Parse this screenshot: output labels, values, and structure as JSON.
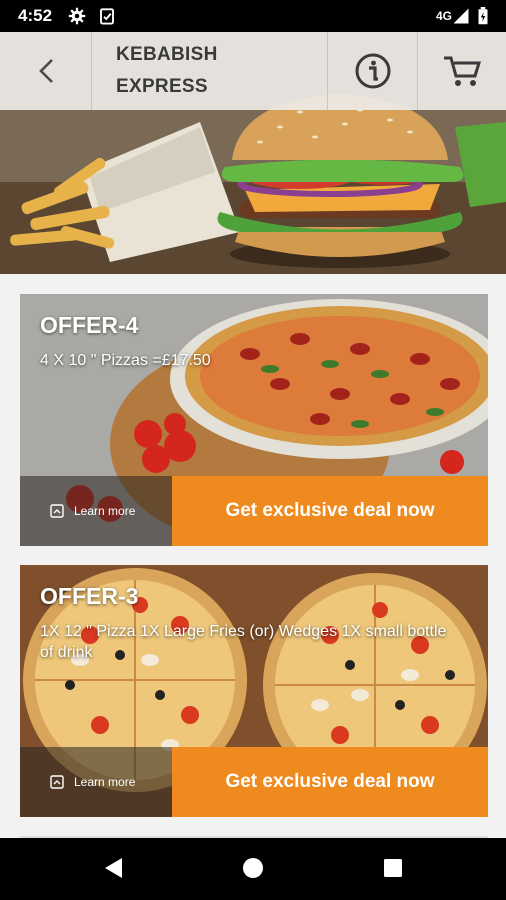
{
  "status_bar": {
    "time": "4:52",
    "network": "4G"
  },
  "header": {
    "title_line1": "KEBABISH",
    "title_line2": "EXPRESS"
  },
  "offers": [
    {
      "title": "OFFER-4",
      "description": "4 X 10 \" Pizzas =£17.50",
      "learn_more": "Learn more",
      "deal_button": "Get exclusive deal now"
    },
    {
      "title": "OFFER-3",
      "description": "1X 12 \" Pizza 1X Large Fries (or) Wedges 1X small bottle of drink",
      "learn_more": "Learn more",
      "deal_button": "Get exclusive deal now"
    }
  ],
  "colors": {
    "accent": "#ef8a1e",
    "header_bg": "#eceae6"
  },
  "icons": [
    "settings-icon",
    "clipboard-icon",
    "signal-icon",
    "battery-icon",
    "back-arrow-icon",
    "info-icon",
    "cart-icon",
    "nav-back-icon",
    "nav-home-icon",
    "nav-recents-icon"
  ]
}
